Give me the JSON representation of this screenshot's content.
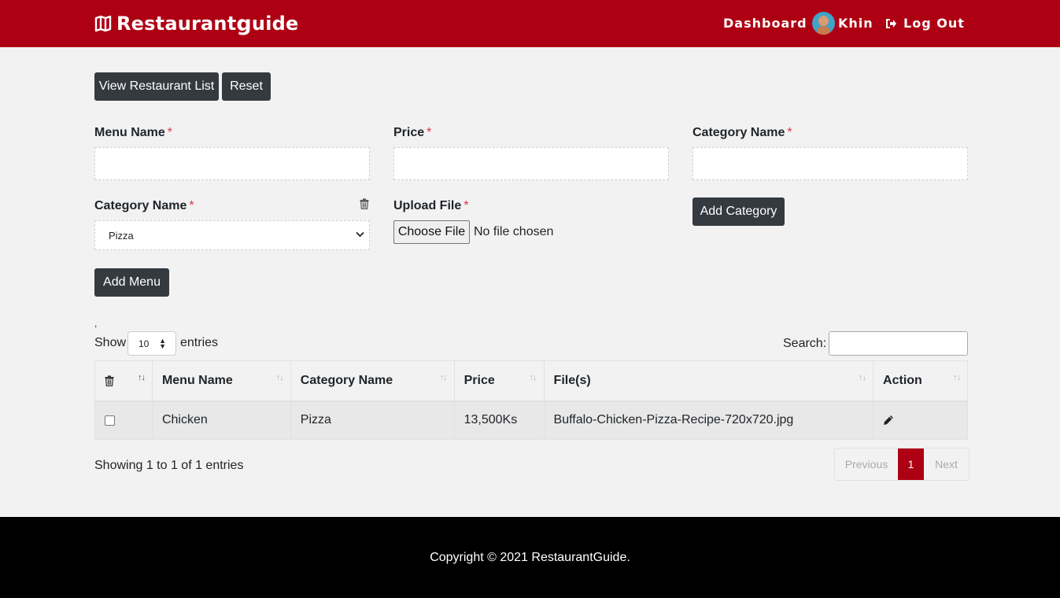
{
  "header": {
    "brand_prefix": "Restaurant",
    "brand_accent": "g",
    "brand_suffix": "uide",
    "nav": {
      "dashboard": "Dashboard",
      "user_name": "Khin",
      "logout": "Log Out"
    },
    "brand_color": "#ae0013"
  },
  "toolbar": {
    "view_list_label": "View Restaurant List",
    "reset_label": "Reset"
  },
  "form": {
    "menu_name_label": "Menu Name",
    "price_label": "Price",
    "category_name_label": "Category Name",
    "category_select_label": "Category Name",
    "category_selected": "Pizza",
    "upload_label": "Upload File",
    "choose_file_label": "Choose File",
    "no_file_text": "No file chosen",
    "required_mark": "*",
    "add_category_label": "Add Category",
    "add_menu_label": "Add Menu"
  },
  "table_controls": {
    "stray_text": ",",
    "show_label": "Show",
    "entries_value": "10",
    "entries_label": "entries",
    "search_label": "Search:",
    "search_value": ""
  },
  "table": {
    "headers": [
      "",
      "Menu Name",
      "Category Name",
      "Price",
      "File(s)",
      "Action"
    ],
    "rows": [
      {
        "checked": false,
        "menu_name": "Chicken",
        "category_name": "Pizza",
        "price": "13,500Ks",
        "file": "Buffalo-Chicken-Pizza-Recipe-720x720.jpg",
        "action_icon": "pencil-icon"
      }
    ]
  },
  "pagination": {
    "info": "Showing 1 to 1 of 1 entries",
    "previous": "Previous",
    "current_page": "1",
    "next": "Next"
  },
  "footer": {
    "copyright": "Copyright © 2021 RestaurantGuide."
  },
  "icons": {
    "brand": "map-icon",
    "logout": "sign-out-icon",
    "delete": "trash-icon",
    "edit": "pencil-icon",
    "sort": "sort-icon"
  }
}
